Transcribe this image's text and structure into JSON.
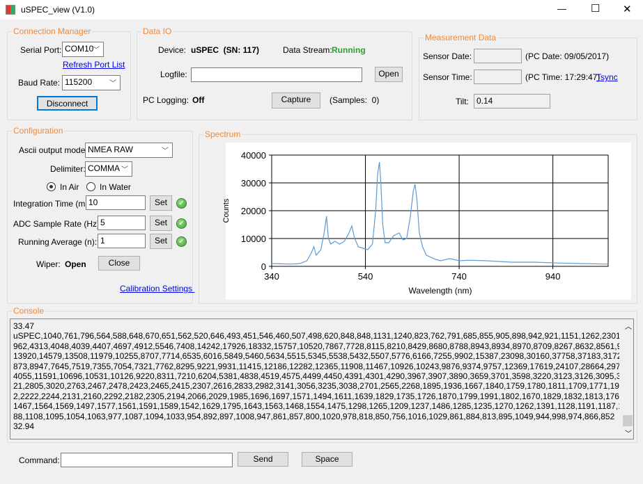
{
  "window": {
    "title": "uSPEC_view (V1.0)",
    "minimize": "—",
    "maximize": "☐",
    "close": "✕"
  },
  "connection": {
    "legend": "Connection Manager",
    "serial_port_label": "Serial Port:",
    "serial_port_value": "COM10",
    "refresh_link": "Refresh Port List",
    "baud_label": "Baud Rate:",
    "baud_value": "115200",
    "disconnect": "Disconnect"
  },
  "dataio": {
    "legend": "Data IO",
    "device_label": "Device:",
    "device_value": "uSPEC  (SN: 117)",
    "stream_label": "Data Stream:",
    "stream_value": "Running",
    "logfile_label": "Logfile:",
    "logfile_value": "",
    "open": "Open",
    "pclog_label": "PC Logging:",
    "pclog_value": "Off",
    "capture": "Capture",
    "samples": "(Samples:  0)"
  },
  "measurement": {
    "legend": "Measurement Data",
    "sensor_date_label": "Sensor Date:",
    "sensor_date_value": "",
    "pc_date": "(PC Date: 09/05/2017)",
    "sensor_time_label": "Sensor Time:",
    "sensor_time_value": "",
    "pc_time": "(PC Time: 17:29:47)",
    "tsync": "Tsync",
    "tilt_label": "Tilt:",
    "tilt_value": "0.14"
  },
  "config": {
    "legend": "Configuration",
    "ascii_label": "Ascii output mode:",
    "ascii_value": "NMEA RAW",
    "delim_label": "Delimiter:",
    "delim_value": "COMMA",
    "in_air": "In Air",
    "in_water": "In Water",
    "selected_medium": "In Air",
    "int_label": "Integration Time (ms):",
    "int_value": "10",
    "adc_label": "ADC Sample Rate (Hz):",
    "adc_value": "5",
    "avg_label": "Running Average (n):",
    "avg_value": "1",
    "set": "Set",
    "wiper_label": "Wiper:",
    "wiper_value": "Open",
    "close": "Close",
    "calib_link": "Calibration Settings "
  },
  "spectrum": {
    "legend": "Spectrum"
  },
  "chart_data": {
    "type": "line",
    "xlabel": "Wavelength (nm)",
    "ylabel": "Counts",
    "xlim": [
      340,
      1058
    ],
    "ylim": [
      0,
      40000
    ],
    "xticks": [
      340,
      540,
      740,
      940
    ],
    "yticks": [
      0,
      10000,
      20000,
      30000,
      40000
    ],
    "grid": true,
    "color": "#5b9bd5",
    "x": [
      340,
      360,
      380,
      400,
      415,
      425,
      430,
      435,
      445,
      452,
      457,
      461,
      466,
      475,
      485,
      495,
      505,
      511,
      517,
      525,
      535,
      545,
      555,
      562,
      566,
      570,
      573,
      577,
      582,
      590,
      600,
      612,
      620,
      628,
      636,
      642,
      646,
      650,
      655,
      662,
      670,
      690,
      700,
      720,
      740,
      760,
      800,
      850,
      900,
      950,
      1000,
      1058
    ],
    "y": [
      1000,
      900,
      800,
      1000,
      2000,
      5000,
      7000,
      4000,
      6000,
      12000,
      18000,
      10000,
      8000,
      9000,
      8000,
      9000,
      12000,
      14500,
      10000,
      7000,
      6500,
      6000,
      8000,
      20000,
      33000,
      37500,
      30000,
      15000,
      8500,
      8500,
      11000,
      12000,
      9500,
      10000,
      18000,
      27000,
      29500,
      24000,
      12000,
      7000,
      4000,
      2500,
      2000,
      2800,
      2000,
      2200,
      2000,
      1500,
      1500,
      1200,
      1000,
      800
    ]
  },
  "console": {
    "legend": "Console",
    "lines": [
      "33.47",
      "uSPEC,1040,761,796,564,588,648,670,651,562,520,646,493,451,546,460,507,498,620,848,848,1131,1240,823,762,791,685,855,905,898,942,921,1151,1262,2301,5010,7005,7502,5",
      "962,4313,4048,4039,4407,4697,4912,5546,7408,14242,17926,18332,15757,10520,7867,7728,8115,8210,8429,8680,8788,8943,8934,8970,8709,8267,8632,8561,9293,10761,12425,",
      "13920,14579,13508,11979,10255,8707,7714,6535,6016,5849,5460,5634,5515,5345,5538,5432,5507,5776,6166,7255,9902,15387,23098,30160,37758,37183,31729,23076,15548,10",
      "873,8947,7645,7519,7355,7054,7321,7762,8295,9221,9931,11415,12186,12282,12365,11908,11467,10926,10243,9876,9374,9757,12369,17619,24107,28664,29784,26139,19103,1",
      "4055,11591,10696,10531,10126,9220,8311,7210,6204,5381,4838,4519,4575,4499,4450,4391,4301,4290,3967,3907,3890,3659,3701,3598,3220,3123,3126,3095,3244,3017,2993,29",
      "21,2805,3020,2763,2467,2478,2423,2465,2415,2307,2616,2833,2982,3141,3056,3235,3038,2701,2565,2268,1895,1936,1667,1840,1759,1780,1811,1709,1771,1995,1960,2073,224",
      "2,2222,2244,2131,2160,2292,2182,2305,2194,2066,2029,1985,1696,1697,1571,1494,1611,1639,1829,1735,1726,1870,1799,1991,1802,1670,1829,1832,1813,1762,1550,1543,1517,",
      "1467,1564,1569,1497,1577,1561,1591,1589,1542,1629,1795,1643,1563,1468,1554,1475,1298,1265,1209,1237,1486,1285,1235,1270,1262,1391,1128,1191,1187,1042,1202,1097,9",
      "88,1108,1095,1054,1063,977,1087,1094,1033,954,892,897,1008,947,861,857,800,1020,978,818,850,756,1016,1029,861,884,813,895,1049,944,998,974,866,852",
      "32.94"
    ]
  },
  "command": {
    "label": "Command:",
    "value": "",
    "send": "Send",
    "space": "Space"
  }
}
